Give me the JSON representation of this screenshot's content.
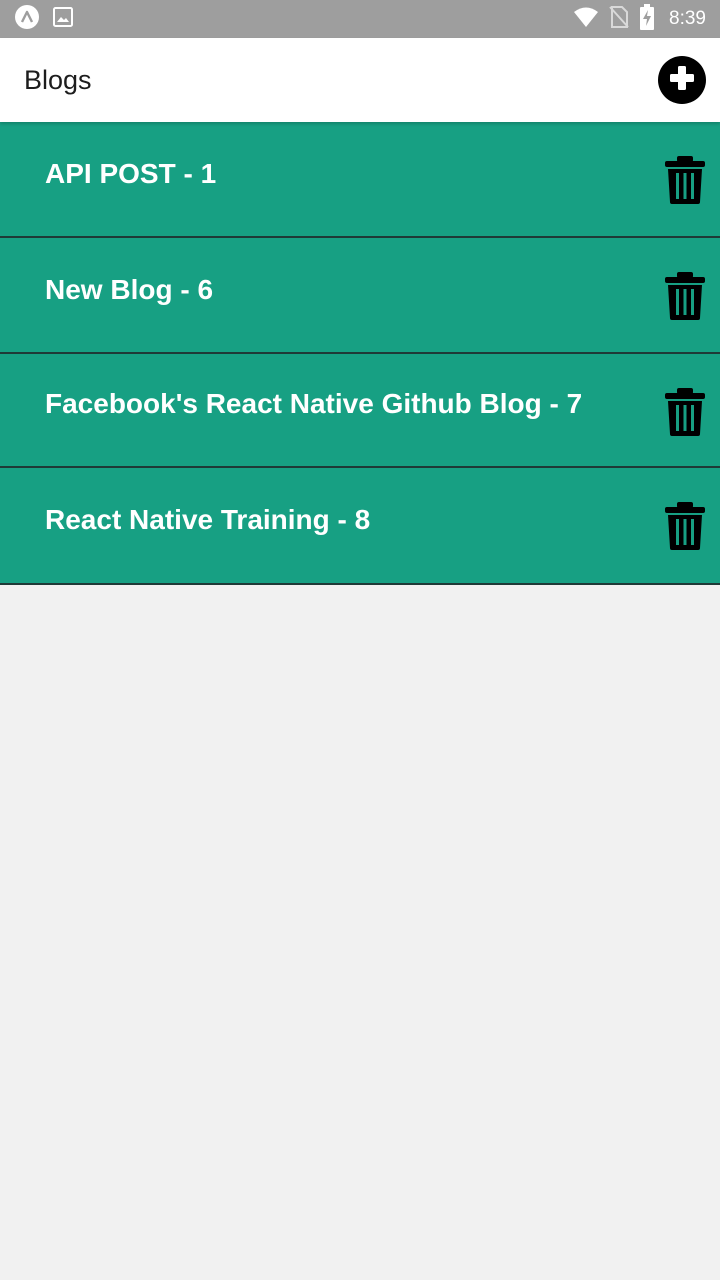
{
  "status_bar": {
    "time": "8:39",
    "icons": [
      "expo-icon",
      "image-icon",
      "wifi-icon",
      "no-sim-icon",
      "battery-charging-icon"
    ]
  },
  "app_bar": {
    "title": "Blogs",
    "add_icon": "plus-circle-icon"
  },
  "blogs": [
    {
      "title": "API POST - 1"
    },
    {
      "title": "New Blog - 6"
    },
    {
      "title": "Facebook's React Native Github Blog - 7"
    },
    {
      "title": "React Native Training - 8"
    }
  ],
  "colors": {
    "status_bar": "#9e9e9e",
    "app_bar": "#ffffff",
    "list_item": "#17a083",
    "divider": "#1f3a37",
    "background": "#f1f1f1",
    "icon": "#000000"
  }
}
